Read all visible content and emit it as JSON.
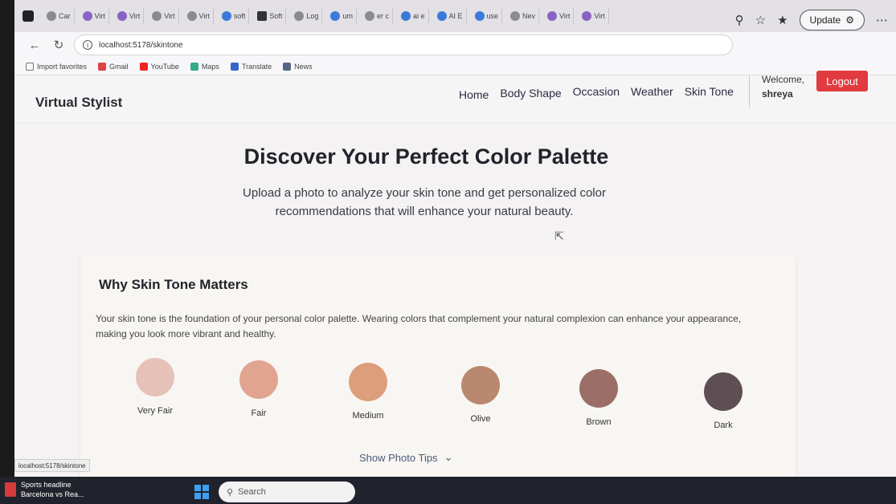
{
  "browser": {
    "tabs": [
      "Car",
      "Virt",
      "Virt",
      "Virt",
      "Virt",
      "soft",
      "Soft",
      "Log",
      "um",
      "er c",
      "ai e",
      "AI E",
      "use",
      "Nev",
      "Virt",
      "Virt"
    ],
    "url": "localhost:5178/skintone",
    "update_label": "Update",
    "bookmarks": [
      "Import favorites",
      "Gmail",
      "YouTube",
      "Maps",
      "Translate",
      "News"
    ],
    "status_url": "localhost:5178/skintone"
  },
  "header": {
    "brand": "Virtual Stylist",
    "nav": [
      "Home",
      "Body Shape",
      "Occasion",
      "Weather",
      "Skin Tone"
    ],
    "welcome": "Welcome,",
    "username": "shreya",
    "logout_label": "Logout"
  },
  "hero": {
    "title": "Discover Your Perfect Color Palette",
    "subtitle": "Upload a photo to analyze your skin tone and get personalized color recommendations that will enhance your natural beauty."
  },
  "card": {
    "title": "Why Skin Tone Matters",
    "text": "Your skin tone is the foundation of your personal color palette. Wearing colors that complement your natural complexion can enhance your appearance, making you look more vibrant and healthy.",
    "swatches": [
      {
        "label": "Very Fair",
        "color": "#e5c1b8"
      },
      {
        "label": "Fair",
        "color": "#e1a490"
      },
      {
        "label": "Medium",
        "color": "#dd9e7c"
      },
      {
        "label": "Olive",
        "color": "#b9886e"
      },
      {
        "label": "Brown",
        "color": "#9b6e67"
      },
      {
        "label": "Dark",
        "color": "#5f4e54"
      }
    ],
    "tips_label": "Show Photo Tips"
  },
  "taskbar": {
    "news_title": "Sports headline",
    "news_sub": "Barcelona vs Rea...",
    "search_placeholder": "Search"
  },
  "colors": {
    "logout": "#e13b3f",
    "link": "#4a5a7a"
  }
}
